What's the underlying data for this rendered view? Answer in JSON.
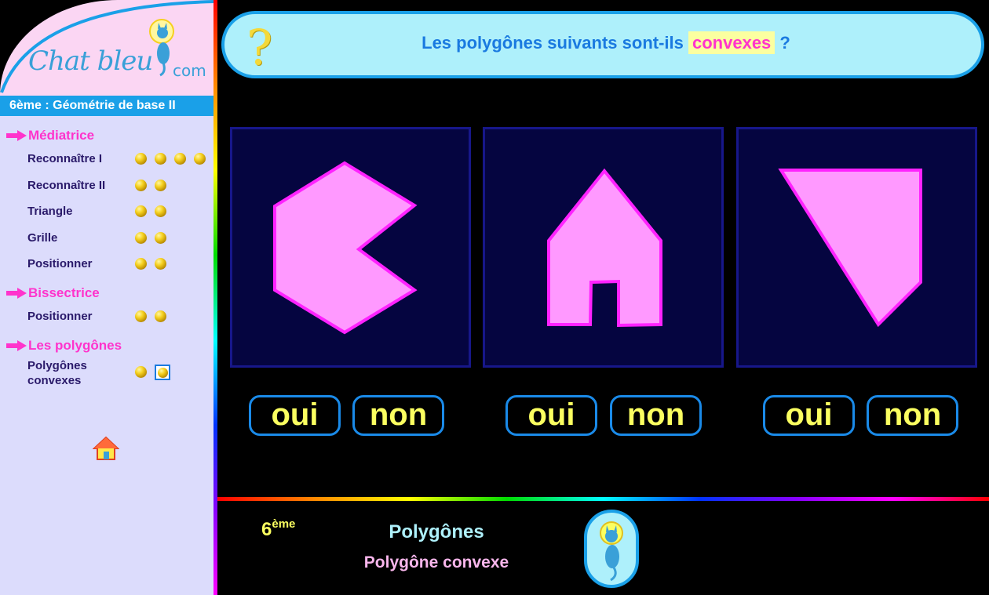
{
  "sidebar": {
    "logo": {
      "text": "Chat bleu",
      "suffix": "com"
    },
    "level_title": "6ème : Géométrie de base II",
    "sections": [
      {
        "title": "Médiatrice",
        "items": [
          {
            "label": "Reconnaître I",
            "dots": 4
          },
          {
            "label": "Reconnaître II",
            "dots": 2
          },
          {
            "label": "Triangle",
            "dots": 2
          },
          {
            "label": "Grille",
            "dots": 2
          },
          {
            "label": "Positionner",
            "dots": 2
          }
        ]
      },
      {
        "title": "Bissectrice",
        "items": [
          {
            "label": "Positionner",
            "dots": 2
          }
        ]
      },
      {
        "title": "Les polygônes",
        "items": [
          {
            "label_line1": "Polygônes",
            "label_line2": "convexes",
            "dots": 2,
            "selected_dot": 2
          }
        ]
      }
    ],
    "home_icon": "house-icon"
  },
  "question": {
    "icon": "question-mark-icon",
    "before": "Les polygônes suivants sont-ils",
    "highlight": "convexes",
    "after": "?"
  },
  "shapes": [
    {
      "name": "pacman-hexagon",
      "fill": "#ff99ff",
      "stroke": "#ff22ff"
    },
    {
      "name": "house-shape",
      "fill": "#ff99ff",
      "stroke": "#ff22ff"
    },
    {
      "name": "quadrilateral",
      "fill": "#ff99ff",
      "stroke": "#ff22ff"
    }
  ],
  "answers": [
    {
      "oui": "oui",
      "non": "non"
    },
    {
      "oui": "oui",
      "non": "non"
    },
    {
      "oui": "oui",
      "non": "non"
    }
  ],
  "footer": {
    "level": "6",
    "level_sup": "ème",
    "title": "Polygônes",
    "subtitle": "Polygône convexe"
  },
  "colors": {
    "accent_blue": "#1aa0e8",
    "magenta": "#ff33cc",
    "yellow": "#fbff60",
    "panel_bg": "#050540"
  }
}
